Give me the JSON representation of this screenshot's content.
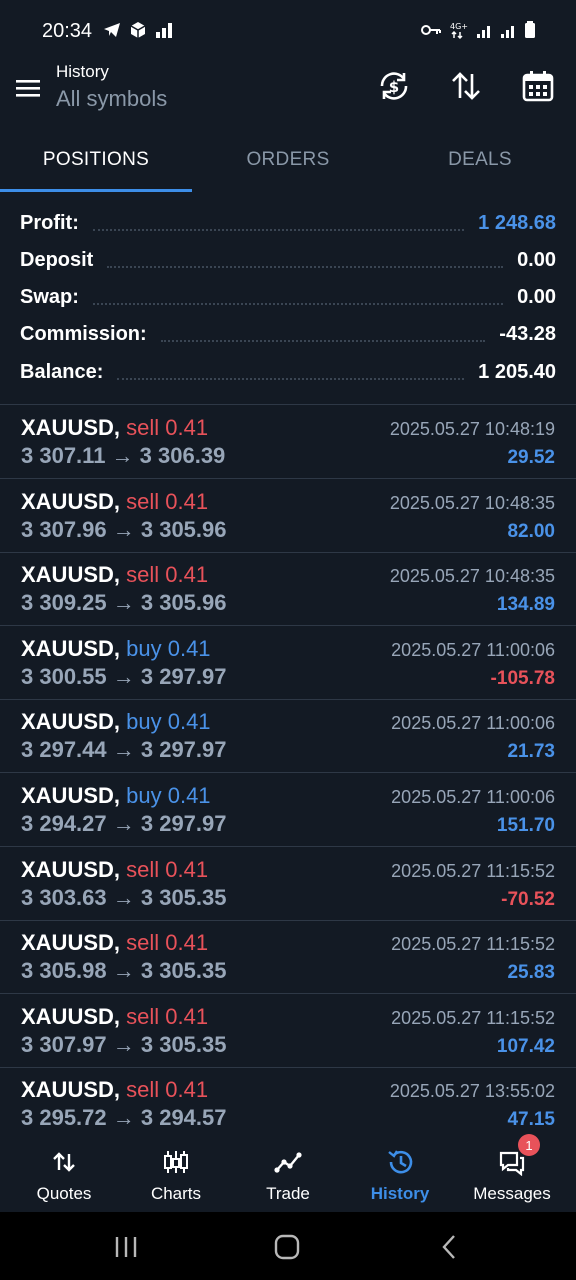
{
  "status_bar": {
    "time": "20:34"
  },
  "header": {
    "title": "History",
    "subtitle": "All symbols"
  },
  "tabs": [
    {
      "label": "POSITIONS",
      "active": true
    },
    {
      "label": "ORDERS",
      "active": false
    },
    {
      "label": "DEALS",
      "active": false
    }
  ],
  "summary": {
    "profit_label": "Profit:",
    "profit_value": "1 248.68",
    "deposit_label": "Deposit",
    "deposit_value": "0.00",
    "swap_label": "Swap:",
    "swap_value": "0.00",
    "commission_label": "Commission:",
    "commission_value": "-43.28",
    "balance_label": "Balance:",
    "balance_value": "1 205.40"
  },
  "deals": [
    {
      "symbol": "XAUUSD,",
      "type": "sell 0.41",
      "side": "sell",
      "prices": "3 307.11 → 3 306.39",
      "time": "2025.05.27 10:48:19",
      "profit": "29.52",
      "sign": "pos"
    },
    {
      "symbol": "XAUUSD,",
      "type": "sell 0.41",
      "side": "sell",
      "prices": "3 307.96 → 3 305.96",
      "time": "2025.05.27 10:48:35",
      "profit": "82.00",
      "sign": "pos"
    },
    {
      "symbol": "XAUUSD,",
      "type": "sell 0.41",
      "side": "sell",
      "prices": "3 309.25 → 3 305.96",
      "time": "2025.05.27 10:48:35",
      "profit": "134.89",
      "sign": "pos"
    },
    {
      "symbol": "XAUUSD,",
      "type": "buy 0.41",
      "side": "buy",
      "prices": "3 300.55 → 3 297.97",
      "time": "2025.05.27 11:00:06",
      "profit": "-105.78",
      "sign": "neg"
    },
    {
      "symbol": "XAUUSD,",
      "type": "buy 0.41",
      "side": "buy",
      "prices": "3 297.44 → 3 297.97",
      "time": "2025.05.27 11:00:06",
      "profit": "21.73",
      "sign": "pos"
    },
    {
      "symbol": "XAUUSD,",
      "type": "buy 0.41",
      "side": "buy",
      "prices": "3 294.27 → 3 297.97",
      "time": "2025.05.27 11:00:06",
      "profit": "151.70",
      "sign": "pos"
    },
    {
      "symbol": "XAUUSD,",
      "type": "sell 0.41",
      "side": "sell",
      "prices": "3 303.63 → 3 305.35",
      "time": "2025.05.27 11:15:52",
      "profit": "-70.52",
      "sign": "neg"
    },
    {
      "symbol": "XAUUSD,",
      "type": "sell 0.41",
      "side": "sell",
      "prices": "3 305.98 → 3 305.35",
      "time": "2025.05.27 11:15:52",
      "profit": "25.83",
      "sign": "pos"
    },
    {
      "symbol": "XAUUSD,",
      "type": "sell 0.41",
      "side": "sell",
      "prices": "3 307.97 → 3 305.35",
      "time": "2025.05.27 11:15:52",
      "profit": "107.42",
      "sign": "pos"
    },
    {
      "symbol": "XAUUSD,",
      "type": "sell 0.41",
      "side": "sell",
      "prices": "3 295.72 → 3 294.57",
      "time": "2025.05.27 13:55:02",
      "profit": "47.15",
      "sign": "pos"
    }
  ],
  "bottom_nav": [
    {
      "label": "Quotes",
      "icon": "quotes-icon"
    },
    {
      "label": "Charts",
      "icon": "charts-icon"
    },
    {
      "label": "Trade",
      "icon": "trade-icon"
    },
    {
      "label": "History",
      "icon": "history-icon",
      "active": true
    },
    {
      "label": "Messages",
      "icon": "messages-icon",
      "badge": "1"
    }
  ],
  "colors": {
    "accent": "#3d8ee8",
    "profit": "#4a92e8",
    "loss": "#e8525a",
    "background": "#131a24"
  }
}
